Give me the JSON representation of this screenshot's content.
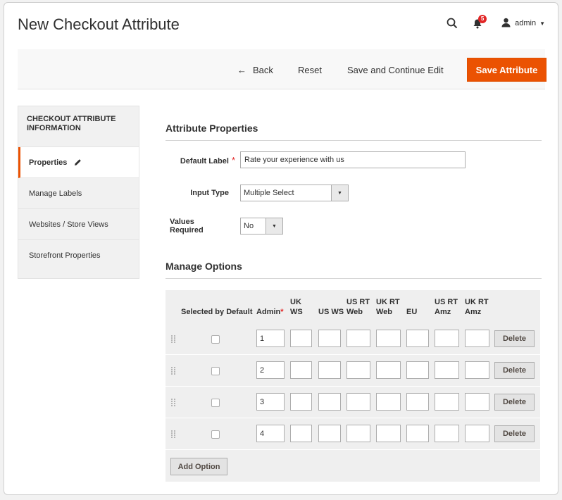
{
  "page": {
    "title": "New Checkout Attribute"
  },
  "header": {
    "notifications_count": "5",
    "user_name": "admin"
  },
  "actions": {
    "back_label": "Back",
    "reset_label": "Reset",
    "save_continue_label": "Save and Continue Edit",
    "save_label": "Save Attribute"
  },
  "sidebar": {
    "title": "Checkout Attribute Information",
    "items": [
      {
        "label": "Properties"
      },
      {
        "label": "Manage Labels"
      },
      {
        "label": "Websites / Store Views"
      },
      {
        "label": "Storefront Properties"
      }
    ]
  },
  "properties": {
    "section_title": "Attribute Properties",
    "default_label": {
      "label": "Default Label",
      "value": "Rate your experience with us"
    },
    "input_type": {
      "label": "Input Type",
      "value": "Multiple Select"
    },
    "values_required": {
      "label": "Values Required",
      "value": "No"
    }
  },
  "options": {
    "section_title": "Manage Options",
    "headers": {
      "selected_by_default": "Selected by Default",
      "admin": "Admin",
      "uk_ws_1": "UK",
      "uk_ws_2": "WS",
      "us_ws": "US WS",
      "us_rt_web_1": "US RT",
      "us_rt_web_2": "Web",
      "uk_rt_web_1": "UK RT",
      "uk_rt_web_2": "Web",
      "eu": "EU",
      "us_rt_amz_1": "US RT",
      "us_rt_amz_2": "Amz",
      "uk_rt_amz_1": "UK RT",
      "uk_rt_amz_2": "Amz"
    },
    "rows": [
      {
        "admin_value": "1"
      },
      {
        "admin_value": "2"
      },
      {
        "admin_value": "3"
      },
      {
        "admin_value": "4"
      }
    ],
    "delete_label": "Delete",
    "add_option_label": "Add Option"
  },
  "colors": {
    "accent": "#eb5202",
    "required": "#e22626"
  }
}
